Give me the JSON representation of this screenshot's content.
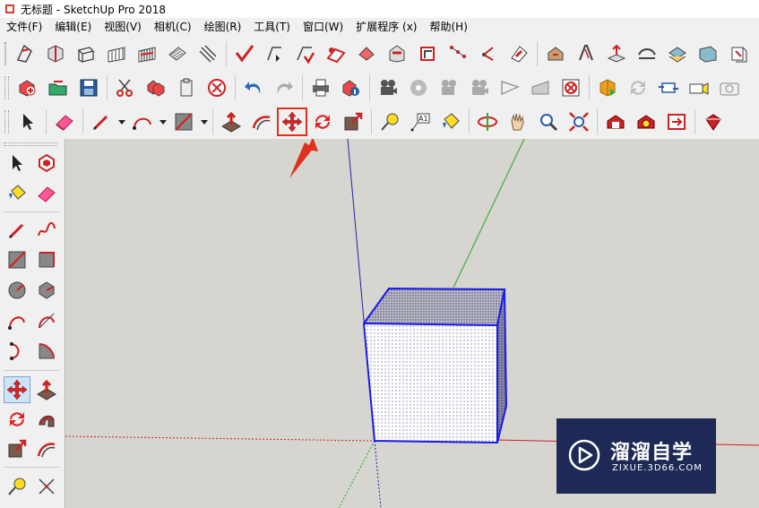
{
  "window": {
    "title": "无标题 - SketchUp Pro 2018",
    "icon": "sketchup-logo-icon"
  },
  "menu": {
    "items": [
      {
        "label": "文件(F)"
      },
      {
        "label": "编辑(E)"
      },
      {
        "label": "视图(V)"
      },
      {
        "label": "相机(C)"
      },
      {
        "label": "绘图(R)"
      },
      {
        "label": "工具(T)"
      },
      {
        "label": "窗口(W)"
      },
      {
        "label": "扩展程序 (x)"
      },
      {
        "label": "帮助(H)"
      }
    ]
  },
  "toolbars": {
    "row1_icons": [
      "x-ray-face-style-icon",
      "back-edges-style-icon",
      "wireframe-style-icon",
      "hidden-line-style-icon",
      "shaded-style-icon",
      "shaded-textures-style-icon",
      "monochrome-style-icon",
      "edges-style-icon",
      "profile-style-icon",
      "depth-cue-style-icon",
      "extension-style-icon",
      "push-pull-section-icon",
      "section-plane-icon",
      "display-section-planes-icon",
      "display-section-cuts-icon",
      "section-fill-icon",
      "warehouse-icon",
      "share-model-icon",
      "extension-warehouse-icon",
      "layout-send-icon",
      "position-camera-icon",
      "walk-icon",
      "look-around-icon",
      "front-view-icon",
      "copy-icon"
    ],
    "row2_icons": [
      "new-file-icon",
      "open-file-icon",
      "save-icon",
      "cut-icon",
      "copy-icon",
      "paste-icon",
      "erase-icon",
      "undo-icon",
      "redo-icon",
      "print-icon",
      "model-info-icon",
      "camera-film-icon",
      "camera-film-2-icon",
      "camera-film-3-icon",
      "camera-film-4-icon",
      "section-cut-icon",
      "section-fill-icon",
      "section-display-icon",
      "add-location-icon",
      "solid-tools-icon",
      "sync-icon",
      "sandbox-icon",
      "camera-icon"
    ],
    "row3_icons": [
      "select-icon",
      "eraser-icon",
      "pencil-icon",
      "arc-icon",
      "rectangle-icon",
      "push-pull-icon",
      "offset-icon",
      "move-icon",
      "rotate-icon",
      "scale-icon",
      "tape-measure-icon",
      "text-icon",
      "paint-bucket-icon",
      "orbit-icon",
      "pan-icon",
      "zoom-icon",
      "zoom-extents-icon",
      "warehouse-icon",
      "extension-warehouse-icon",
      "layout-send-icon",
      "ruby-icon"
    ],
    "highlighted_tool": "move-icon"
  },
  "left_toolbar_icons": [
    "select-icon",
    "component-icon",
    "paint-bucket-icon",
    "eraser-icon",
    "line-icon",
    "freehand-icon",
    "rectangle-icon",
    "rotated-rectangle-icon",
    "circle-icon",
    "polygon-icon",
    "arc-icon",
    "two-point-arc-icon",
    "three-point-arc-icon",
    "pie-icon",
    "move-icon",
    "push-pull-icon",
    "rotate-icon",
    "follow-me-icon",
    "scale-icon",
    "offset-icon",
    "tape-measure-icon",
    "dimension-icon"
  ],
  "colors": {
    "accent_red": "#e0301e",
    "axis_blue": "#2222aa",
    "axis_green": "#22aa22",
    "axis_red": "#cc2222",
    "viewport_bg": "#d6d5d0",
    "selection_blue": "#1a1aee"
  },
  "watermark": {
    "brand": "溜溜自学",
    "url": "ZIXUE.3D66.COM",
    "icon": "play-logo-icon"
  }
}
